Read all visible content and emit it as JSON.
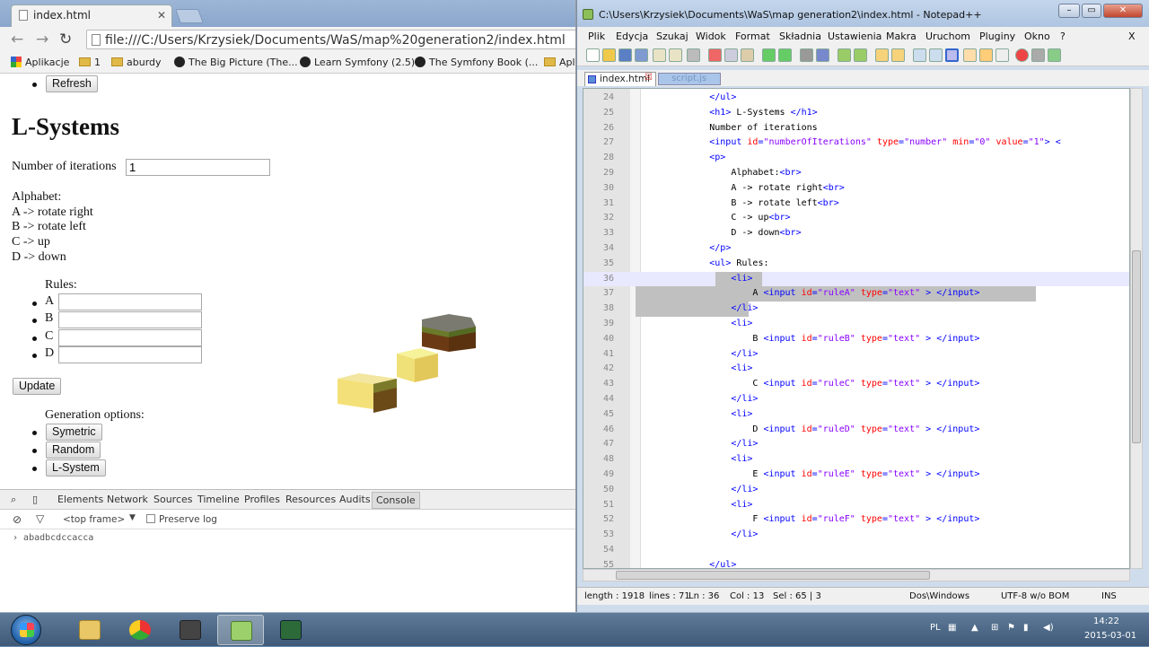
{
  "chrome": {
    "tab_title": "index.html",
    "url": "file:///C:/Users/Krzysiek/Documents/WaS/map%20generation2/index.html",
    "bookmarks": [
      "Aplikacje",
      "1",
      "aburdy",
      "The Big Picture (The...",
      "Learn Symfony (2.5)",
      "The Symfony Book (...",
      "Apli"
    ]
  },
  "page": {
    "refresh_label": "Refresh",
    "heading": "L-Systems",
    "iterations_label": "Number of iterations",
    "iterations_value": "1",
    "alphabet_title": "Alphabet:",
    "alphabet": [
      "A -> rotate right",
      "B -> rotate left",
      "C -> up",
      "D -> down"
    ],
    "rules_title": "Rules:",
    "rules": [
      "A",
      "B",
      "C",
      "D"
    ],
    "update_label": "Update",
    "generation_title": "Generation options:",
    "generation_buttons": [
      "Symetric",
      "Random",
      "L-System"
    ]
  },
  "devtools": {
    "tabs": [
      "Elements",
      "Network",
      "Sources",
      "Timeline",
      "Profiles",
      "Resources",
      "Audits",
      "Console"
    ],
    "frame": "<top frame>",
    "preserve_log": "Preserve log",
    "log": "abadbcdccacca"
  },
  "notepad": {
    "title": "C:\\Users\\Krzysiek\\Documents\\WaS\\map generation2\\index.html - Notepad++",
    "menu": [
      "Plik",
      "Edycja",
      "Szukaj",
      "Widok",
      "Format",
      "Składnia",
      "Ustawienia",
      "Makra",
      "Uruchom",
      "Pluginy",
      "Okno",
      "?"
    ],
    "tab_active": "index.html",
    "tab_other": "script.js",
    "line_numbers": [
      "24",
      "25",
      "26",
      "27",
      "28",
      "29",
      "30",
      "31",
      "32",
      "33",
      "34",
      "35",
      "36",
      "37",
      "38",
      "39",
      "40",
      "41",
      "42",
      "43",
      "44",
      "45",
      "46",
      "47",
      "48",
      "49",
      "50",
      "51",
      "52",
      "53",
      "54",
      "55"
    ],
    "code_lines": [
      "            </ul>",
      "            <h1> L-Systems </h1>",
      "            Number of iterations",
      "            <input id=\"numberOfIterations\" type=\"number\" min=\"0\" value=\"1\"> <",
      "            <p>",
      "                Alphabet:<br>",
      "                A -> rotate right<br>",
      "                B -> rotate left<br>",
      "                C -> up<br>",
      "                D -> down<br>",
      "            </p>",
      "            <ul> Rules:",
      "                <li>",
      "                    A <input id=\"ruleA\" type=\"text\" > </input>",
      "                </li>",
      "                <li>",
      "                    B <input id=\"ruleB\" type=\"text\" > </input>",
      "                </li>",
      "                <li>",
      "                    C <input id=\"ruleC\" type=\"text\" > </input>",
      "                </li>",
      "                <li>",
      "                    D <input id=\"ruleD\" type=\"text\" > </input>",
      "                </li>",
      "                <li>",
      "                    E <input id=\"ruleE\" type=\"text\" > </input>",
      "                </li>",
      "                <li>",
      "                    F <input id=\"ruleF\" type=\"text\" > </input>",
      "                </li>",
      "",
      "            </ul>"
    ],
    "status": {
      "length": "length : 1918",
      "lines": "lines : 71",
      "ln": "Ln : 36",
      "col": "Col : 13",
      "sel": "Sel : 65 | 3",
      "eol": "Dos\\Windows",
      "encoding": "UTF-8 w/o BOM",
      "mode": "INS"
    }
  },
  "taskbar": {
    "lang": "PL",
    "time": "14:22",
    "date": "2015-03-01"
  },
  "colors": {
    "tag": "#0000ff",
    "attr": "#ff0000",
    "value": "#8000ff",
    "selection": "#c0c0c0"
  }
}
